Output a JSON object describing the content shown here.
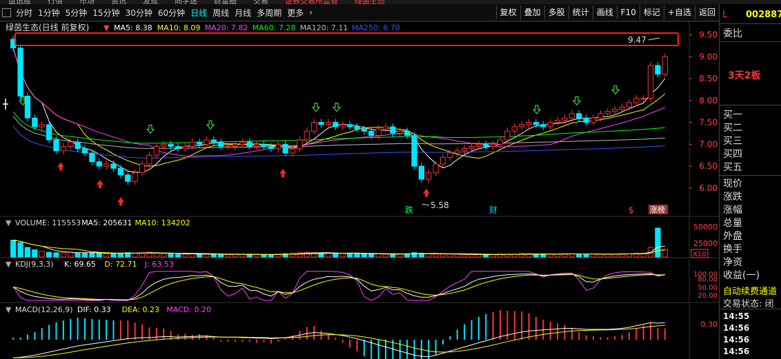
{
  "top_menu": [
    "盘选股",
    "行情",
    "市场",
    "资讯",
    "发现",
    "同学迷",
    "财富圈",
    "交易",
    "证券交易所监管",
    "绿茵生态"
  ],
  "toolbar": {
    "periods": [
      "分时",
      "1分钟",
      "5分钟",
      "15分钟",
      "30分钟",
      "60分钟",
      "日线",
      "周线",
      "月线",
      "多周期",
      "更多"
    ],
    "active_period": "日线",
    "buttons": [
      "复权",
      "叠加",
      "多股",
      "统计",
      "画线",
      "F10",
      "标记",
      "+自选",
      "返回"
    ]
  },
  "side": {
    "market_flag": "L",
    "code": "002887",
    "weibi": "委比",
    "annotation": "3天2板",
    "buy_levels": [
      "买一",
      "买二",
      "买三",
      "买四",
      "买五"
    ],
    "quote_labels": [
      "现价",
      "涨跌",
      "涨幅",
      "总量",
      "外盘",
      "换手",
      "净资",
      "收益(一)"
    ],
    "promo": "自动续费通道",
    "status_label": "交易状态: 闭",
    "times": [
      "14:55",
      "14:56",
      "14:56",
      "14:56"
    ]
  },
  "main_panel": {
    "legend_title": "绿茵生态(日线 前复权)",
    "ma": [
      {
        "label": "MA5: 8.38",
        "color": "#ffffff"
      },
      {
        "label": "MA10: 8.09",
        "color": "#ffff00"
      },
      {
        "label": "MA20: 7.82",
        "color": "#ff44ff"
      },
      {
        "label": "MA60: 7.28",
        "color": "#00ff00"
      },
      {
        "label": "MA120: 7.11",
        "color": "#bbbbbb"
      },
      {
        "label": "MA250: 6.70",
        "color": "#3355ff"
      }
    ],
    "y_ticks": [
      "9.50",
      "9.00",
      "8.50",
      "8.00",
      "7.50",
      "7.00",
      "6.50",
      "6.00"
    ],
    "high_label": "9.47",
    "low_label": "5.58",
    "markers": [
      "跌",
      "财",
      "$",
      "涨榜"
    ]
  },
  "volume_panel": {
    "legend": [
      {
        "label": "VOLUME: 115553",
        "color": "#dddddd"
      },
      {
        "label": "MA5: 205631",
        "color": "#ffffff"
      },
      {
        "label": "MA10: 134202",
        "color": "#ffff00"
      }
    ],
    "y_ticks": [
      "50000",
      "25000"
    ],
    "unit": "X10"
  },
  "kdj_panel": {
    "legend": [
      {
        "label": "KDJ(9,3,3)",
        "color": "#dddddd"
      },
      {
        "label": "K: 69.65",
        "color": "#ffffff"
      },
      {
        "label": "D: 72.71",
        "color": "#ffff00"
      },
      {
        "label": "J: 63.53",
        "color": "#ff44ff"
      }
    ],
    "y_ticks": [
      "100.00",
      "80.00",
      "50.00",
      "20.00"
    ]
  },
  "macd_panel": {
    "legend": [
      {
        "label": "MACD(12,26,9)",
        "color": "#dddddd"
      },
      {
        "label": "DIF: 0.33",
        "color": "#ffffff"
      },
      {
        "label": "DEA: 0.23",
        "color": "#ffff00"
      },
      {
        "label": "MACD: 0.20",
        "color": "#ff44ff"
      }
    ],
    "y_ticks": [
      "0.30"
    ]
  },
  "chart_data": {
    "type": "candlestick",
    "ylim": [
      5.4,
      9.65
    ],
    "closes": [
      9.2,
      8.1,
      7.6,
      7.4,
      7.45,
      7.1,
      6.85,
      6.95,
      7.05,
      6.9,
      6.8,
      6.6,
      6.5,
      6.55,
      6.45,
      6.3,
      6.15,
      6.35,
      6.55,
      6.75,
      6.95,
      7.0,
      6.95,
      6.9,
      6.95,
      7.05,
      7.0,
      7.1,
      7.05,
      6.95,
      6.95,
      7.0,
      7.05,
      6.95,
      7.0,
      6.95,
      6.9,
      7.0,
      6.8,
      6.9,
      7.1,
      7.3,
      7.5,
      7.45,
      7.5,
      7.4,
      7.45,
      7.4,
      7.35,
      7.3,
      7.2,
      7.35,
      7.4,
      7.25,
      7.3,
      7.2,
      6.5,
      6.2,
      6.35,
      6.55,
      6.7,
      6.8,
      6.85,
      6.9,
      6.95,
      7.0,
      6.95,
      7.0,
      7.1,
      7.3,
      7.4,
      7.45,
      7.5,
      7.45,
      7.4,
      7.5,
      7.55,
      7.6,
      7.7,
      7.6,
      7.5,
      7.6,
      7.7,
      7.75,
      7.8,
      7.85,
      7.95,
      8.05,
      8.05,
      8.8,
      8.6,
      9.0
    ],
    "volumes": [
      35,
      30,
      20,
      15,
      12,
      10,
      9,
      9,
      10,
      8,
      8,
      9,
      8,
      7,
      7,
      8,
      9,
      8,
      9,
      10,
      8,
      7,
      7,
      6,
      6,
      7,
      6,
      6,
      6,
      5,
      5,
      6,
      6,
      5,
      5,
      5,
      5,
      6,
      7,
      8,
      9,
      10,
      9,
      8,
      8,
      7,
      7,
      8,
      7,
      6,
      6,
      7,
      6,
      6,
      6,
      7,
      9,
      8,
      7,
      6,
      6,
      6,
      6,
      5,
      5,
      5,
      5,
      5,
      6,
      6,
      6,
      7,
      7,
      6,
      6,
      6,
      6,
      7,
      7,
      6,
      6,
      6,
      6,
      6,
      6,
      7,
      7,
      8,
      8,
      20,
      60,
      16
    ],
    "dif": [
      -0.35,
      -0.34,
      -0.32,
      -0.3,
      -0.27,
      -0.24,
      -0.21,
      -0.18,
      -0.15,
      -0.12,
      -0.1,
      -0.08,
      -0.06,
      -0.04,
      -0.02,
      0,
      0.02,
      0.03,
      0.04,
      0.04,
      0.05,
      0.06,
      0.06,
      0.05,
      0.06,
      0.06,
      0.07,
      0.07,
      0.06,
      0.05,
      0.05,
      0.05,
      0.04,
      0.04,
      0.03,
      0.03,
      0.02,
      0.03,
      0.04,
      0.06,
      0.09,
      0.12,
      0.14,
      0.13,
      0.12,
      0.1,
      0.08,
      0.05,
      0.02,
      -0.02,
      -0.06,
      -0.1,
      -0.14,
      -0.18,
      -0.22,
      -0.26,
      -0.3,
      -0.32,
      -0.33,
      -0.3,
      -0.26,
      -0.22,
      -0.18,
      -0.14,
      -0.1,
      -0.06,
      -0.02,
      0.02,
      0.06,
      0.09,
      0.12,
      0.15,
      0.17,
      0.18,
      0.19,
      0.2,
      0.21,
      0.22,
      0.22,
      0.21,
      0.2,
      0.2,
      0.2,
      0.2,
      0.21,
      0.22,
      0.24,
      0.27,
      0.3,
      0.33,
      0.32,
      0.33
    ]
  }
}
